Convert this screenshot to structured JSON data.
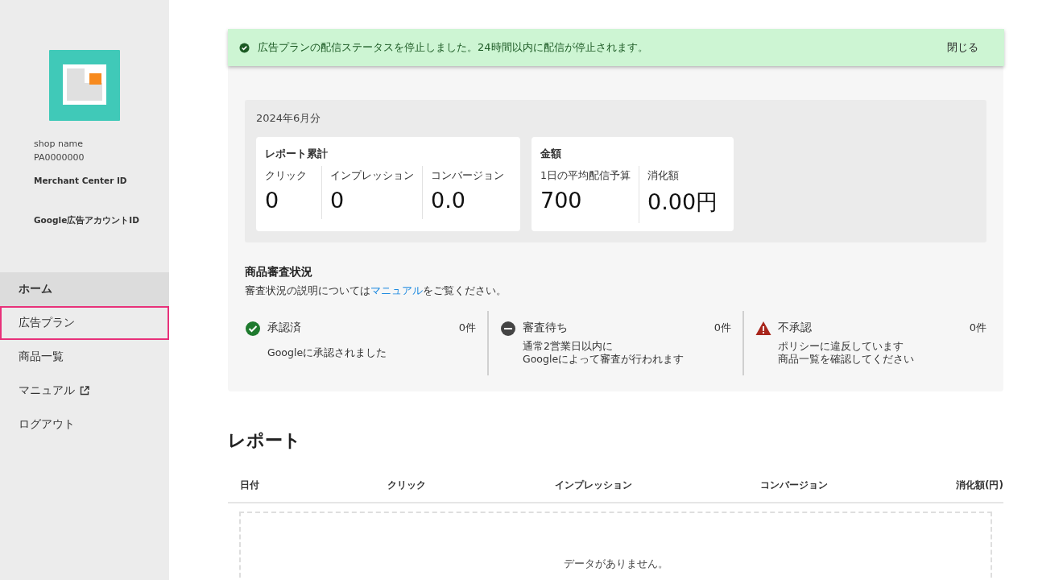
{
  "sidebar": {
    "shop_name": "shop name",
    "shop_id": "PA0000000",
    "merchant_center_label": "Merchant Center ID",
    "google_ads_label": "Google広告アカウントID",
    "items": [
      {
        "label": "ホーム",
        "selected": true,
        "focused": false,
        "external": false
      },
      {
        "label": "広告プラン",
        "selected": false,
        "focused": true,
        "external": false
      },
      {
        "label": "商品一覧",
        "selected": false,
        "focused": false,
        "external": false
      },
      {
        "label": "マニュアル",
        "selected": false,
        "focused": false,
        "external": true
      },
      {
        "label": "ログアウト",
        "selected": false,
        "focused": false,
        "external": false
      }
    ]
  },
  "toast": {
    "message": "広告プランの配信ステータスを停止しました。24時間以内に配信が停止されます。",
    "close": "閉じる"
  },
  "status": {
    "period": "2024年6月分",
    "cards": [
      {
        "title": "レポート累計",
        "metrics": [
          {
            "label": "クリック",
            "value": "0"
          },
          {
            "label": "インプレッション",
            "value": "0"
          },
          {
            "label": "コンバージョン",
            "value": "0.0"
          }
        ]
      },
      {
        "title": "金額",
        "metrics": [
          {
            "label": "1日の平均配信予算",
            "value": "700"
          },
          {
            "label": "消化額",
            "value": "0.00円"
          }
        ]
      }
    ]
  },
  "review": {
    "title": "商品審査状況",
    "note_before": "審査状況の説明については",
    "note_link": "マニュアル",
    "note_after": "をご覧ください。",
    "items": [
      {
        "kind": "approved",
        "label": "承認済",
        "count": "0件",
        "lines": [
          "Googleに承認されました"
        ]
      },
      {
        "kind": "pending",
        "label": "審査待ち",
        "count": "0件",
        "lines": [
          "通常2営業日以内に",
          "Googleによって審査が行われます"
        ]
      },
      {
        "kind": "rejected",
        "label": "不承認",
        "count": "0件",
        "lines": [
          "ポリシーに違反しています",
          "商品一覧を確認してください"
        ]
      }
    ]
  },
  "report": {
    "title": "レポート",
    "columns": [
      "日付",
      "クリック",
      "インプレッション",
      "コンバージョン",
      "消化額(円)"
    ],
    "empty": "データがありません。"
  }
}
